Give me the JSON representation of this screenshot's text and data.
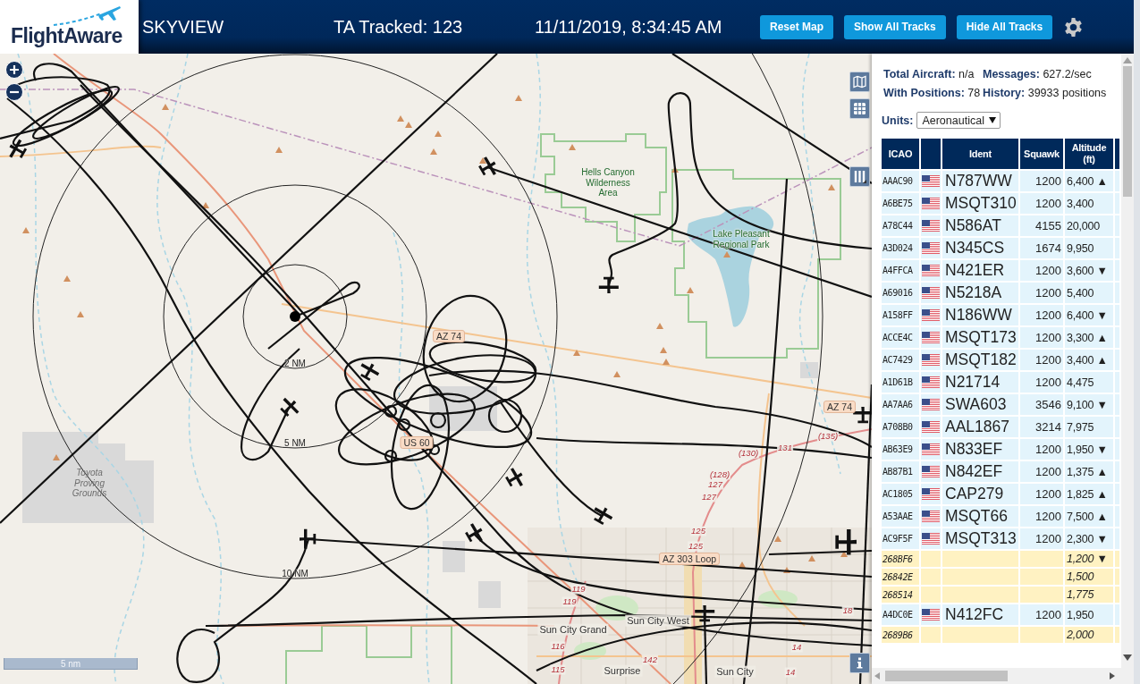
{
  "header": {
    "logo": "FlightAware",
    "title": "SKYVIEW",
    "tracked": "TA Tracked: 123",
    "clock": "11/11/2019, 8:34:45 AM",
    "buttons": [
      "Reset Map",
      "Show All Tracks",
      "Hide All Tracks"
    ]
  },
  "map": {
    "labels": [
      {
        "text": "Hells Canyon Wilderness Area",
        "kind": "park"
      },
      {
        "text": "Lake Pleasant Regional Park",
        "kind": "park"
      },
      {
        "text": "AZ 74",
        "kind": "shield"
      },
      {
        "text": "AZ 74",
        "kind": "shield"
      },
      {
        "text": "US 60",
        "kind": "shield"
      },
      {
        "text": "(135)",
        "kind": "route"
      },
      {
        "text": "131",
        "kind": "route"
      },
      {
        "text": "(130)",
        "kind": "route"
      },
      {
        "text": "Toyota Proving Grounds",
        "kind": "landmark"
      },
      {
        "text": "(128)",
        "kind": "route"
      },
      {
        "text": "127",
        "kind": "route"
      },
      {
        "text": "127",
        "kind": "route"
      },
      {
        "text": "125",
        "kind": "route"
      },
      {
        "text": "125",
        "kind": "route"
      },
      {
        "text": "AZ 303 Loop",
        "kind": "shield"
      },
      {
        "text": "119",
        "kind": "route"
      },
      {
        "text": "119",
        "kind": "route"
      },
      {
        "text": "18",
        "kind": "route"
      },
      {
        "text": "Sun City West",
        "kind": "town"
      },
      {
        "text": "Sun City Grand",
        "kind": "town"
      },
      {
        "text": "116",
        "kind": "route"
      },
      {
        "text": "14",
        "kind": "route"
      },
      {
        "text": "142",
        "kind": "route"
      },
      {
        "text": "115",
        "kind": "route"
      },
      {
        "text": "Surprise",
        "kind": "town"
      },
      {
        "text": "Sun City",
        "kind": "town"
      },
      {
        "text": "14",
        "kind": "route"
      }
    ],
    "range_rings": [
      "2 NM",
      "5 NM",
      "10 NM"
    ],
    "scale": "5 nm"
  },
  "stats": [
    {
      "label": "Total Aircraft:",
      "value": "n/a"
    },
    {
      "label": "Messages:",
      "value": "627.2/sec"
    },
    {
      "label": "With Positions:",
      "value": "78"
    },
    {
      "label": "History:",
      "value": "39933 positions"
    }
  ],
  "units": {
    "label": "Units:",
    "value": "Aeronautical"
  },
  "table": {
    "columns": [
      "ICAO",
      "Ident",
      "Squawk",
      "Altitude (ft)"
    ],
    "rows": [
      {
        "kind": "adsb",
        "icao": "AAAC90",
        "ident": "N787WW",
        "squawk": "1200",
        "altitude": "6,400 ▲"
      },
      {
        "kind": "adsb",
        "icao": "A6BE75",
        "ident": "MSQT310",
        "squawk": "1200",
        "altitude": "3,400"
      },
      {
        "kind": "adsb",
        "icao": "A78C44",
        "ident": "N586AT",
        "squawk": "4155",
        "altitude": "20,000"
      },
      {
        "kind": "adsb",
        "icao": "A3D024",
        "ident": "N345CS",
        "squawk": "1674",
        "altitude": "9,950"
      },
      {
        "kind": "adsb",
        "icao": "A4FFCA",
        "ident": "N421ER",
        "squawk": "1200",
        "altitude": "3,600 ▼"
      },
      {
        "kind": "adsb",
        "icao": "A69016",
        "ident": "N5218A",
        "squawk": "1200",
        "altitude": "5,400"
      },
      {
        "kind": "adsb",
        "icao": "A158FF",
        "ident": "N186WW",
        "squawk": "1200",
        "altitude": "6,400 ▼"
      },
      {
        "kind": "adsb",
        "icao": "ACCE4C",
        "ident": "MSQT173",
        "squawk": "1200",
        "altitude": "3,300 ▲"
      },
      {
        "kind": "adsb",
        "icao": "AC7429",
        "ident": "MSQT182",
        "squawk": "1200",
        "altitude": "3,400 ▲"
      },
      {
        "kind": "adsb",
        "icao": "A1D61B",
        "ident": "N21714",
        "squawk": "1200",
        "altitude": "4,475"
      },
      {
        "kind": "adsb",
        "icao": "AA7AA6",
        "ident": "SWA603",
        "squawk": "3546",
        "altitude": "9,100 ▼"
      },
      {
        "kind": "adsb",
        "icao": "A708B0",
        "ident": "AAL1867",
        "squawk": "3214",
        "altitude": "7,975"
      },
      {
        "kind": "adsb",
        "icao": "AB63E9",
        "ident": "N833EF",
        "squawk": "1200",
        "altitude": "1,950 ▼"
      },
      {
        "kind": "adsb",
        "icao": "AB87B1",
        "ident": "N842EF",
        "squawk": "1200",
        "altitude": "1,375 ▲"
      },
      {
        "kind": "adsb",
        "icao": "AC1805",
        "ident": "CAP279",
        "squawk": "1200",
        "altitude": "1,825 ▲"
      },
      {
        "kind": "adsb",
        "icao": "A53AAE",
        "ident": "MSQT66",
        "squawk": "1200",
        "altitude": "7,500 ▲"
      },
      {
        "kind": "adsb",
        "icao": "AC9F5F",
        "ident": "MSQT313",
        "squawk": "1200",
        "altitude": "2,300 ▼"
      },
      {
        "kind": "other",
        "icao": "268BF6",
        "altitude": "1,200 ▼"
      },
      {
        "kind": "other",
        "icao": "26842E",
        "altitude": "1,500"
      },
      {
        "kind": "other",
        "icao": "268514",
        "altitude": "1,775"
      },
      {
        "kind": "adsb",
        "icao": "A4DC0E",
        "ident": "N412FC",
        "squawk": "1200",
        "altitude": "1,950"
      },
      {
        "kind": "other",
        "icao": "2689B6",
        "altitude": "2,000"
      }
    ]
  }
}
